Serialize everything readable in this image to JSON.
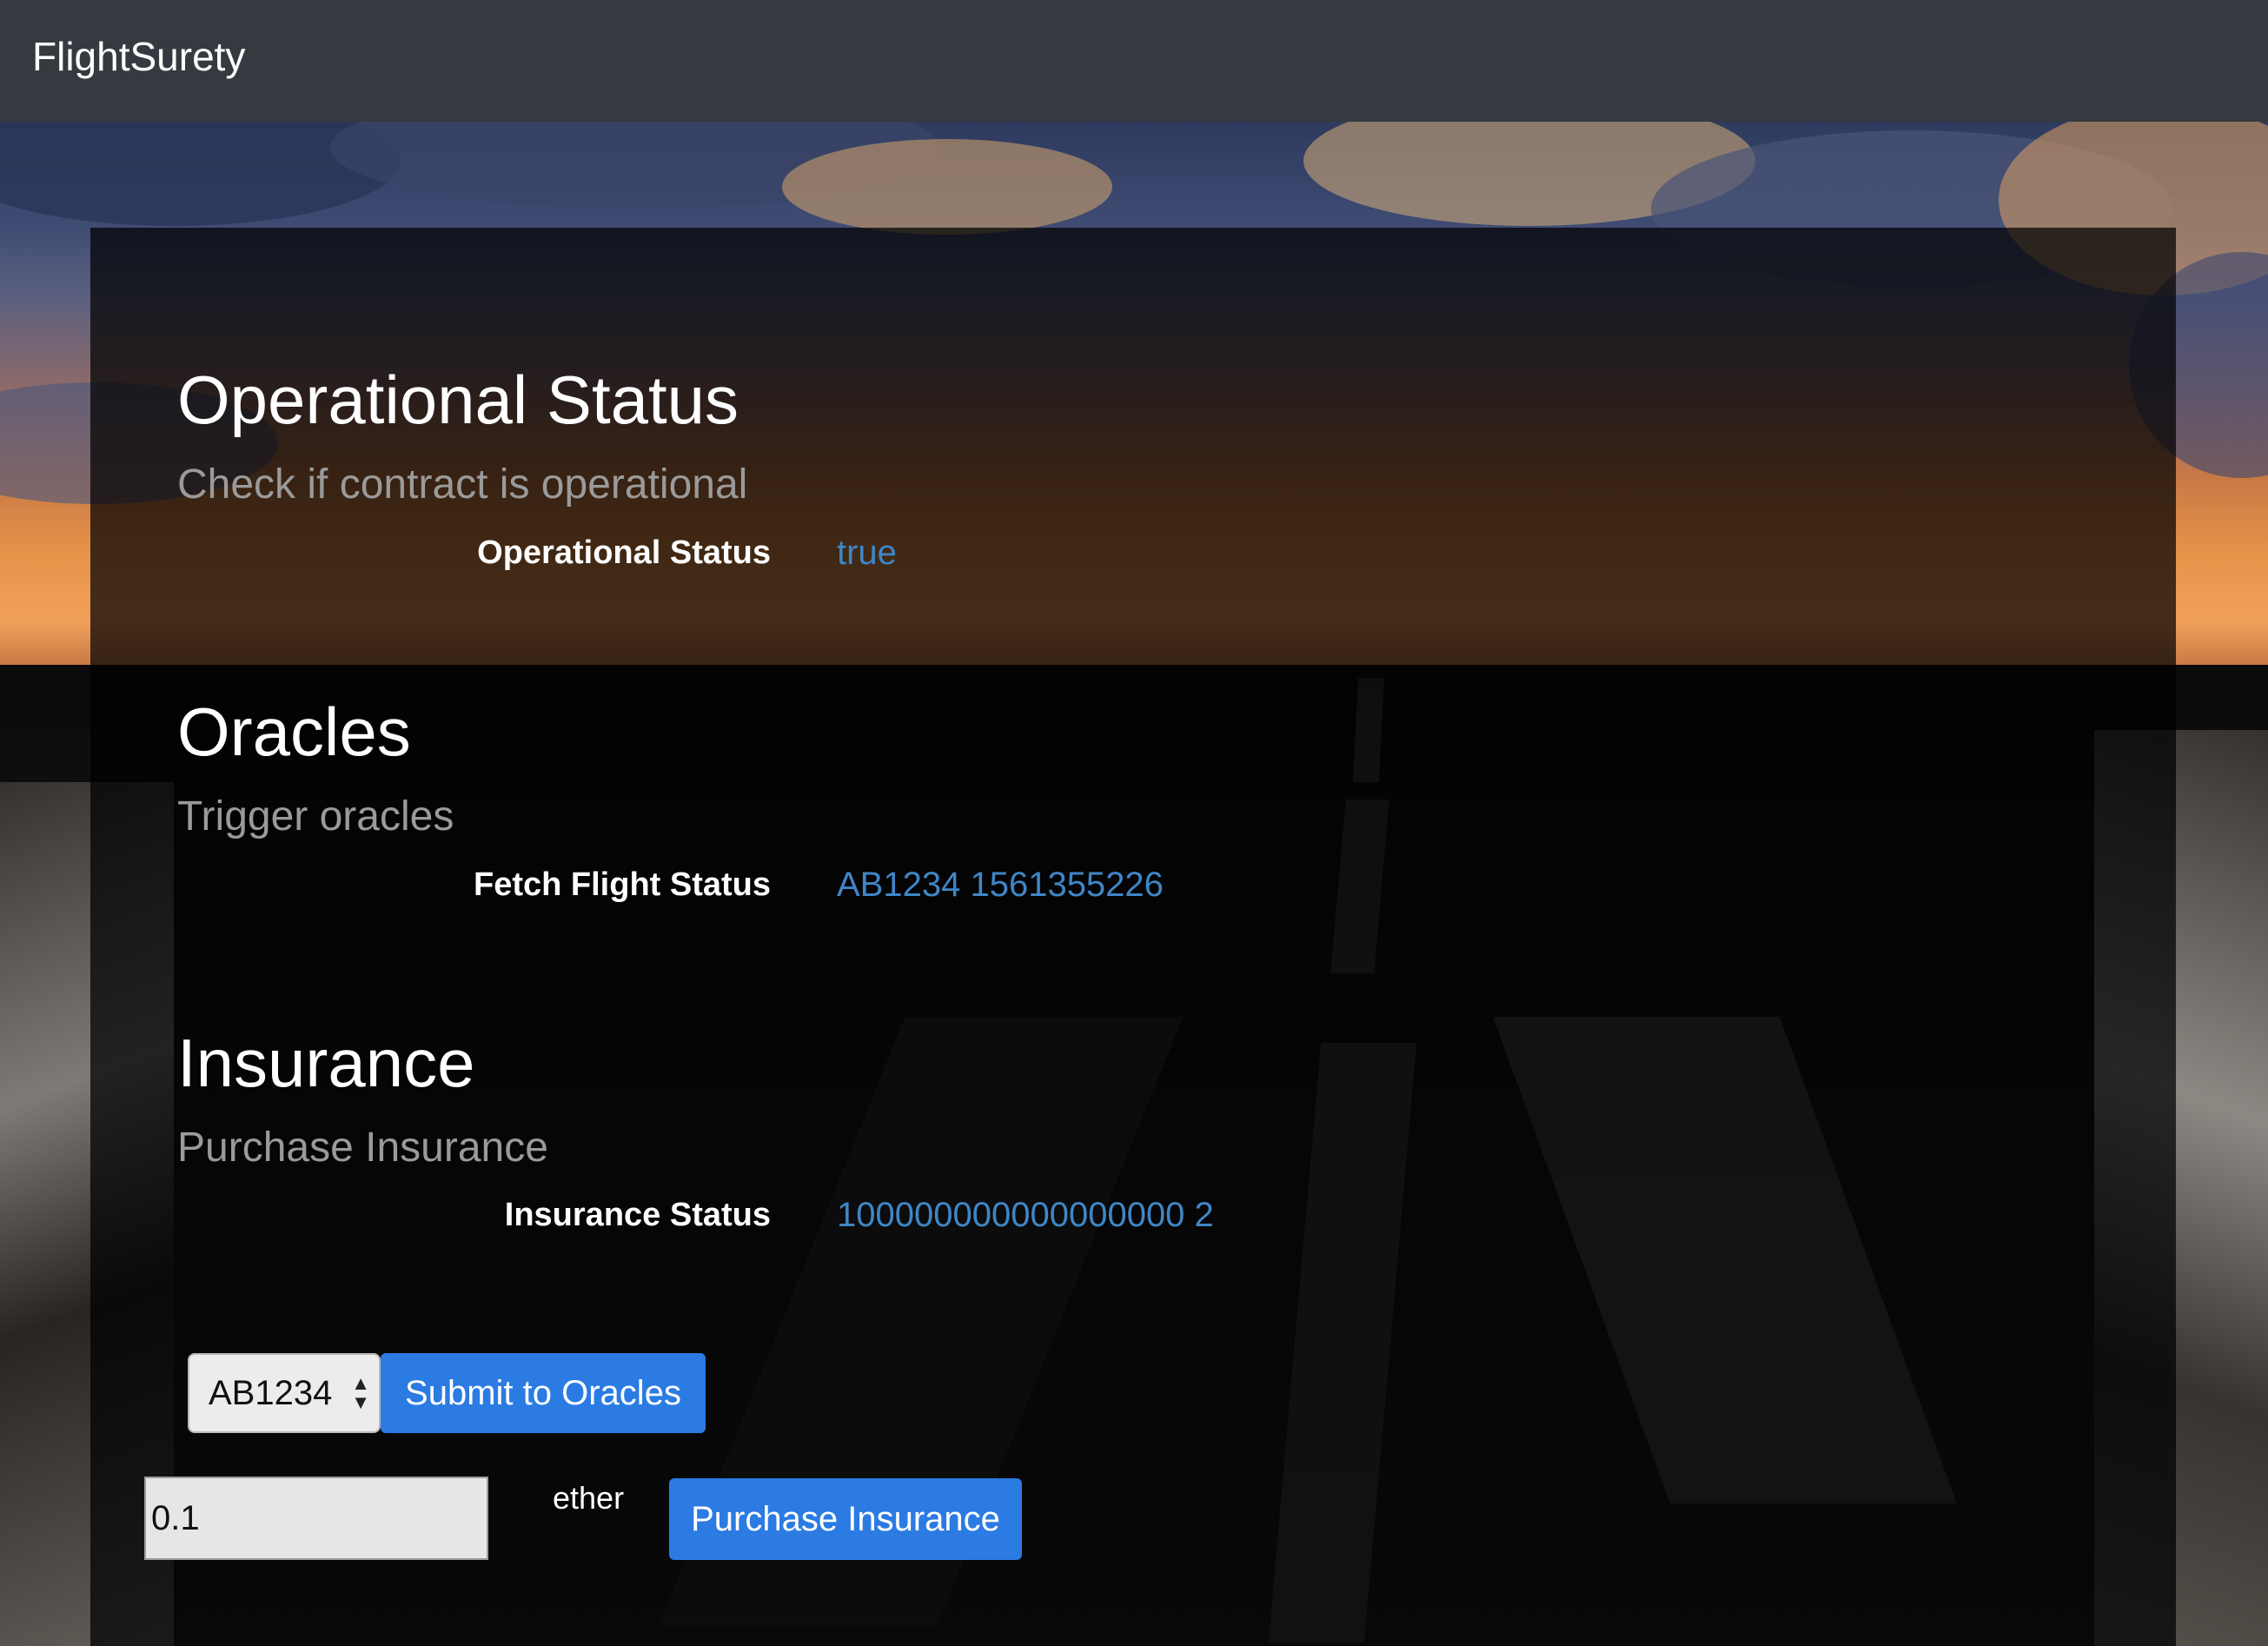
{
  "navbar": {
    "brand": "FlightSurety"
  },
  "sections": {
    "operational": {
      "title": "Operational Status",
      "subtitle": "Check if contract is operational",
      "label": "Operational Status",
      "value": "true"
    },
    "oracles": {
      "title": "Oracles",
      "subtitle": "Trigger oracles",
      "label": "Fetch Flight Status",
      "value": "AB1234 1561355226"
    },
    "insurance": {
      "title": "Insurance",
      "subtitle": "Purchase Insurance",
      "label": "Insurance Status",
      "value": "100000000000000000 2"
    }
  },
  "controls": {
    "flight_select": "AB1234",
    "submit_label": "Submit to Oracles",
    "amount": "0.1",
    "unit": "ether",
    "purchase_label": "Purchase Insurance"
  },
  "colors": {
    "navbar": "#343a40",
    "accent": "#2b7be3",
    "value": "#3f86c6"
  }
}
